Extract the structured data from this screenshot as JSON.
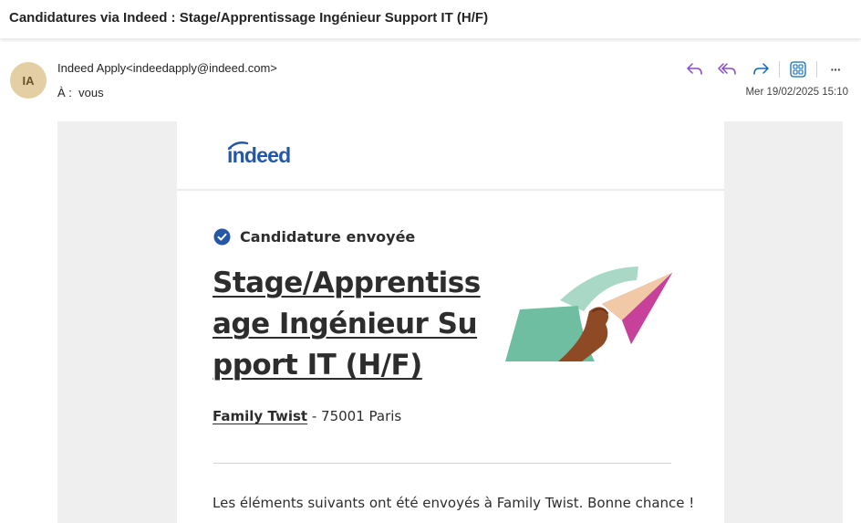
{
  "subject": "Candidatures via Indeed : Stage/Apprentissage Ingénieur Support IT (H/F)",
  "header": {
    "avatar_initials": "IA",
    "sender": "Indeed Apply<indeedapply@indeed.com>",
    "to_label": "À :",
    "to_value": "vous",
    "date": "Mer 19/02/2025 15:10",
    "actions": [
      "reply-icon",
      "reply-all-icon",
      "forward-icon",
      "apps-icon",
      "more-icon"
    ],
    "more_label": "···"
  },
  "email": {
    "logo_text": "indeed",
    "status": "Candidature envoyée",
    "job_title": "Stage/Apprentissage Ingénieur Support IT (H/F)",
    "company": "Family Twist",
    "location_sep": " - ",
    "location": "75001 Paris",
    "body": "Les éléments suivants ont été envoyés à Family Twist. Bonne chance !"
  },
  "colors": {
    "indeed_blue": "#2557a7",
    "action_purple": "#8a4bc9",
    "action_blue": "#0f6cbd",
    "avatar_bg": "#e3cfa3"
  }
}
